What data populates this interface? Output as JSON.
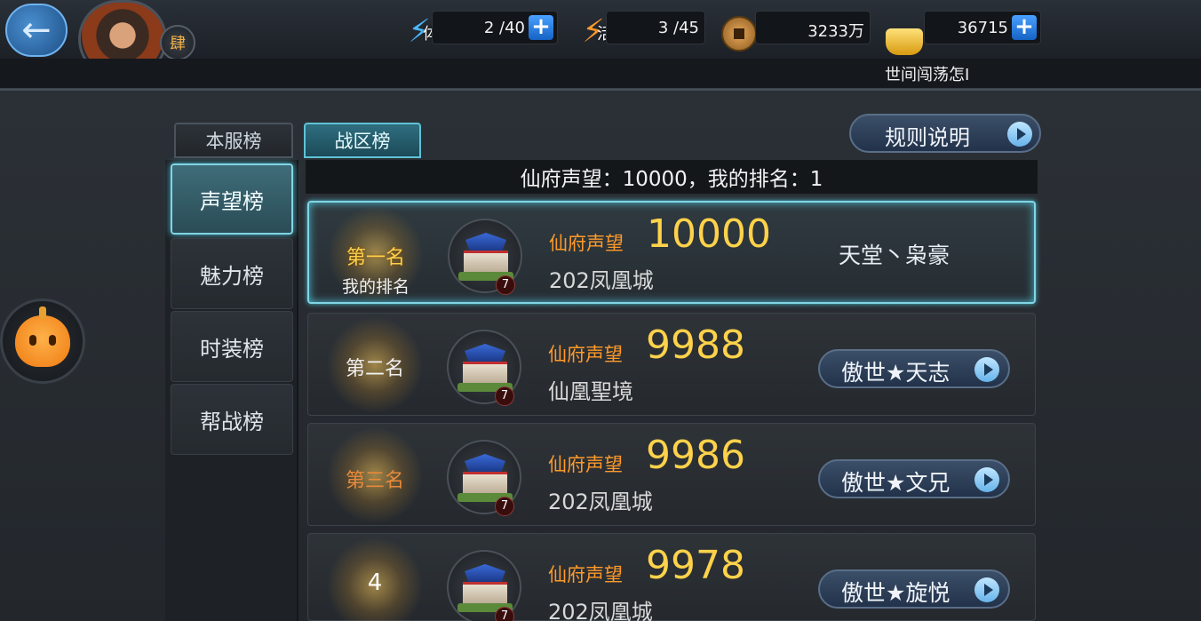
{
  "top": {
    "marquee": "世间闯荡怎I",
    "vip_badge": "肆",
    "stamina": {
      "icon_label": "体",
      "value": "2 /40"
    },
    "vitality": {
      "icon_label": "活",
      "value": "3 /45"
    },
    "coins": {
      "value": "3233万"
    },
    "ingots": {
      "value": "36715"
    },
    "plus": "+"
  },
  "tabs": {
    "server": "本服榜",
    "zone": "战区榜"
  },
  "rules_button": "规则说明",
  "categories": [
    "声望榜",
    "魅力榜",
    "时装榜",
    "帮战榜"
  ],
  "header": "仙府声望：10000，我的排名：1",
  "rows": [
    {
      "rank": "第一名",
      "rank_sub": "我的排名",
      "level": "7",
      "rep_label": "仙府声望",
      "reputation": "10000",
      "city": "202凤凰城",
      "leader": "天堂丶枭豪"
    },
    {
      "rank": "第二名",
      "level": "7",
      "rep_label": "仙府声望",
      "reputation": "9988",
      "city": "仙凰聖境",
      "leader": "傲世★天志"
    },
    {
      "rank": "第三名",
      "level": "7",
      "rep_label": "仙府声望",
      "reputation": "9986",
      "city": "202凤凰城",
      "leader": "傲世★文兄"
    },
    {
      "rank": "4",
      "level": "7",
      "rep_label": "仙府声望",
      "reputation": "9978",
      "city": "202凤凰城",
      "leader": "傲世★旋悦"
    }
  ],
  "colors": {
    "accent": "#7fd6e6",
    "gold": "#ffd24a",
    "orange": "#ff9a2a"
  }
}
